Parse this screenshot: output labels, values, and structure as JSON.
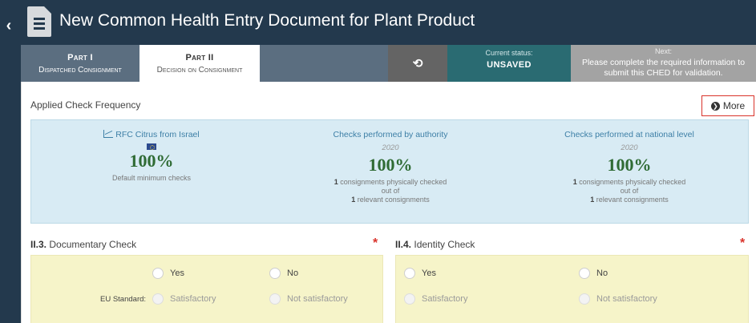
{
  "header": {
    "back_icon": "chevron-left-icon",
    "doc_icon": "document-icon",
    "title": "New Common Health Entry Document for Plant Product"
  },
  "tabs": [
    {
      "part": "Part I",
      "label": "Dispatched Consignment"
    },
    {
      "part": "Part II",
      "label": "Decision on Consignment"
    }
  ],
  "status_bar": {
    "history_icon": "history-icon",
    "current_status_label": "Current status:",
    "current_status_value": "UNSAVED",
    "next_label": "Next:",
    "next_text": "Please complete the required information to submit this CHED for validation."
  },
  "applied_check": {
    "title": "Applied Check Frequency",
    "more_label": "More",
    "columns": [
      {
        "heading": "RFC Citrus from Israel",
        "year": "",
        "percent": "100%",
        "note": "Default minimum checks"
      },
      {
        "heading": "Checks performed by authority",
        "year": "2020",
        "percent": "100%",
        "line1_count": "1",
        "line1_text": "consignments physically checked",
        "line2": "out of",
        "line3_count": "1",
        "line3_text": "relevant consignments"
      },
      {
        "heading": "Checks performed at national level",
        "year": "2020",
        "percent": "100%",
        "line1_count": "1",
        "line1_text": "consignments physically checked",
        "line2": "out of",
        "line3_count": "1",
        "line3_text": "relevant consignments"
      }
    ]
  },
  "documentary_check": {
    "number": "II.3.",
    "title": "Documentary Check",
    "required_mark": "*",
    "yes": "Yes",
    "no": "No",
    "eu_standard_label": "EU Standard:",
    "satisfactory": "Satisfactory",
    "not_satisfactory": "Not satisfactory"
  },
  "identity_check": {
    "number": "II.4.",
    "title": "Identity Check",
    "required_mark": "*",
    "yes": "Yes",
    "no": "No",
    "satisfactory": "Satisfactory",
    "not_satisfactory": "Not satisfactory"
  },
  "colors": {
    "header_bg": "#23394d",
    "status_bg": "#2a6b72",
    "next_bg": "#a3a3a3",
    "panel_bg": "#d8ebf4",
    "percent_green": "#2f6b34",
    "required_red": "#d9332b",
    "yellow_bg": "#f6f4c9"
  }
}
